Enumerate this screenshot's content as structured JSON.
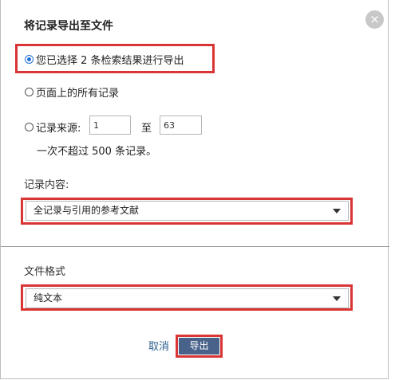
{
  "dialog": {
    "title": "将记录导出至文件",
    "close_icon": "×"
  },
  "selection": {
    "option_selected": "您已选择 2 条检索结果进行导出",
    "option_all_on_page": "页面上的所有记录",
    "option_range": "记录来源:",
    "range_from": "1",
    "range_to_label": "至",
    "range_to": "63",
    "range_note": "一次不超过 500 条记录。"
  },
  "content": {
    "label": "记录内容:",
    "selected": "全记录与引用的参考文献"
  },
  "format": {
    "label": "文件格式",
    "selected": "纯文本"
  },
  "actions": {
    "cancel": "取消",
    "export": "导出"
  },
  "colors": {
    "highlight": "#d93535",
    "export_button": "#48628a",
    "link": "#2c5f8e",
    "radio_accent": "#1e6fd9"
  }
}
